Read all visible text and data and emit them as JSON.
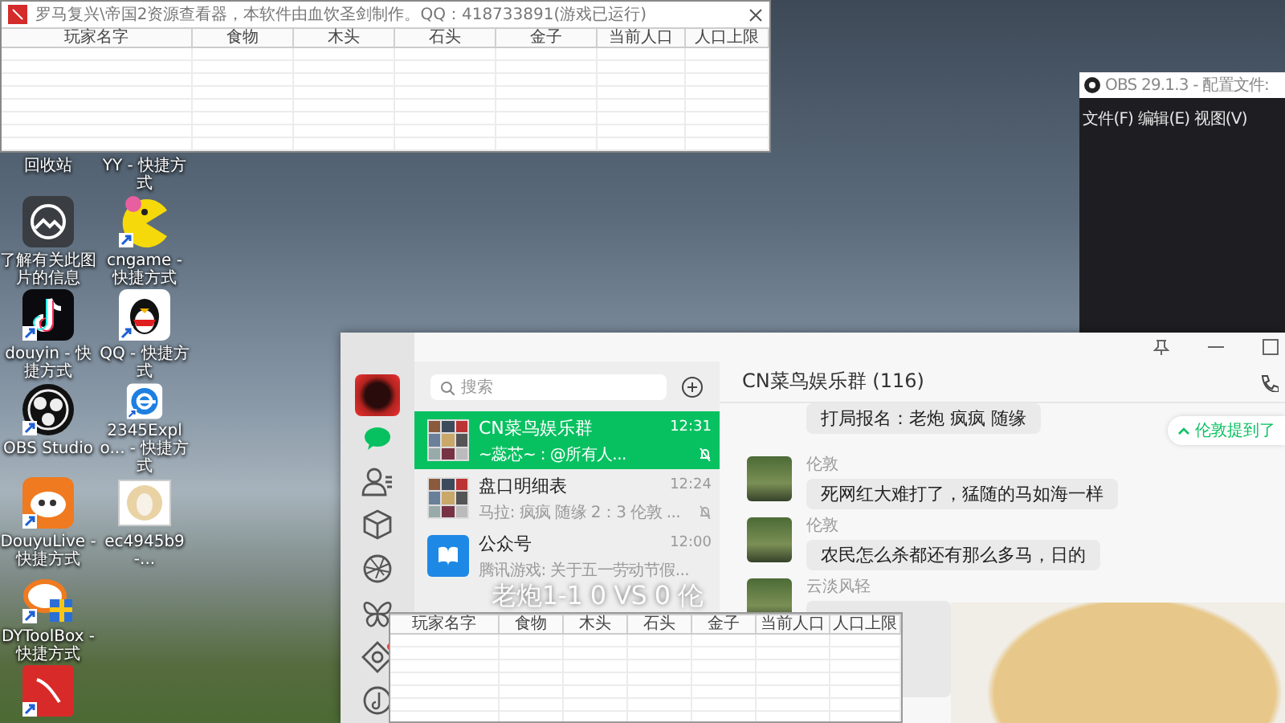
{
  "resource_viewer": {
    "title": "罗马复兴\\帝国2资源查看器，本软件由血饮圣剑制作。QQ：418733891(游戏已运行)",
    "columns": [
      "玩家名字",
      "食物",
      "木头",
      "石头",
      "金子",
      "当前人口",
      "人口上限"
    ]
  },
  "desktop_icons": [
    {
      "kind": "recycle-bin",
      "label": "回收站"
    },
    {
      "kind": "photo-info",
      "label": "了解有关此图片的信息",
      "shortcut": false
    },
    {
      "kind": "douyin",
      "label": "douyin - 快捷方式",
      "shortcut": true
    },
    {
      "kind": "obs",
      "label": "OBS Studio",
      "shortcut": true
    },
    {
      "kind": "douyulive",
      "label": "DouyuLive - 快捷方式",
      "shortcut": true
    },
    {
      "kind": "dytoolbox",
      "label": "DYToolBox - 快捷方式",
      "shortcut": true
    },
    {
      "kind": "red-app",
      "shortcut": true
    },
    {
      "kind": "yy",
      "label": "YY - 快捷方式"
    },
    {
      "kind": "cngame",
      "label": "cngame - 快捷方式",
      "shortcut": true
    },
    {
      "kind": "qq",
      "label": "QQ - 快捷方式",
      "shortcut": true
    },
    {
      "kind": "browser",
      "label": "2345Explo... - 快捷方式",
      "shortcut": true
    },
    {
      "kind": "image-file",
      "label": "ec4945b9-...",
      "shortcut": false
    }
  ],
  "obs_window": {
    "title": "OBS 29.1.3 - 配置文件:",
    "menu": [
      "文件(F)",
      "编辑(E)",
      "视图(V)"
    ]
  },
  "wechat": {
    "nav": [
      {
        "kind": "chats",
        "selected": true,
        "unread": false
      },
      {
        "kind": "contacts",
        "selected": false,
        "unread": false
      },
      {
        "kind": "cube",
        "selected": false,
        "unread": false
      },
      {
        "kind": "aperture",
        "selected": false,
        "unread": false
      },
      {
        "kind": "butterfly",
        "selected": false,
        "unread": false
      },
      {
        "kind": "diamond",
        "selected": false,
        "unread": true
      },
      {
        "kind": "music",
        "selected": false,
        "unread": false
      }
    ],
    "search": {
      "placeholder": "搜索"
    },
    "chats": [
      {
        "kind": "collage",
        "name": "CN菜鸟娱乐群",
        "time": "12:31",
        "preview": "~蕊芯~ : @所有人...",
        "muted": true,
        "selected": true
      },
      {
        "kind": "collage",
        "name": "盘口明细表",
        "time": "12:24",
        "preview": "马拉: 疯疯 随缘 2：3 伦敦 ...",
        "muted": true,
        "selected": false
      },
      {
        "kind": "bookmark",
        "name": "公众号",
        "time": "12:00",
        "preview": "腾讯游戏: 关于五一劳动节假...",
        "muted": false,
        "selected": false
      }
    ],
    "chat": {
      "title": "CN菜鸟娱乐群 (116)",
      "mention": "伦敦提到了",
      "messages": [
        {
          "kind": "text",
          "text": "打局报名：老炮 疯疯 随缘"
        },
        {
          "kind": "text",
          "sender": "伦敦",
          "text": "死网红大难打了，猛随的马如海一样"
        },
        {
          "kind": "text",
          "sender": "伦敦",
          "text": "农民怎么杀都还有那么多马，日的"
        },
        {
          "kind": "sticker",
          "sender": "云淡风轻"
        }
      ]
    }
  },
  "overlay_caption": "老炮1-1 0 VS 0 伦",
  "resource_viewer_2": {
    "columns": [
      "玩家名字",
      "食物",
      "木头",
      "石头",
      "金子",
      "当前人口",
      "人口上限"
    ]
  }
}
